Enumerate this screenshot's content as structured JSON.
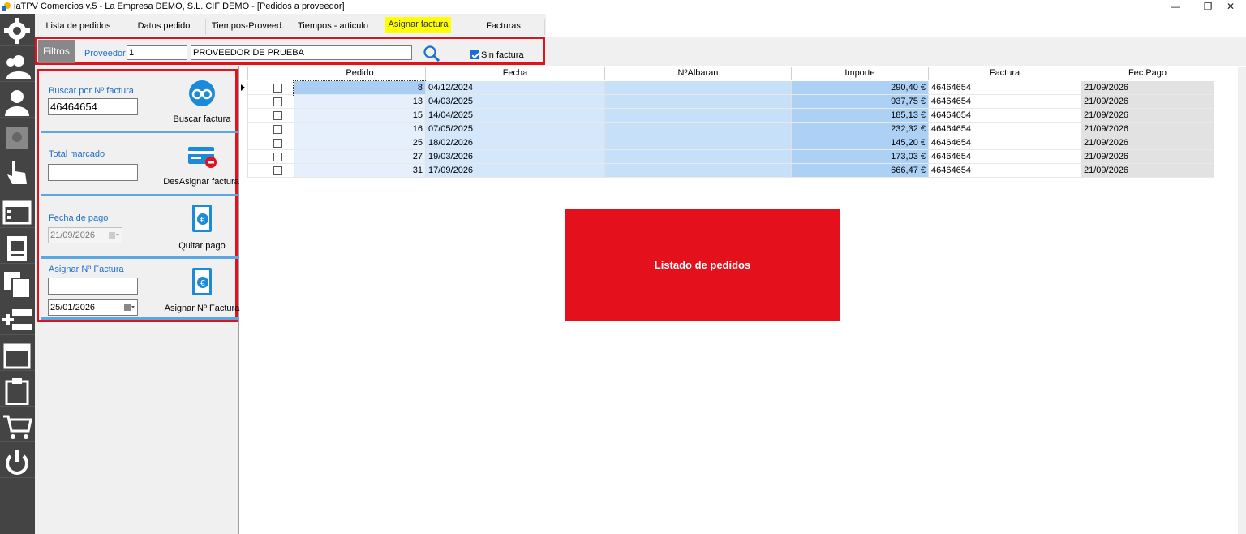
{
  "window": {
    "title": "iaTPV Comercios v.5 - La Empresa DEMO, S.L. CIF DEMO - [Pedidos a proveedor]",
    "controls": {
      "minimize": "—",
      "maximize": "❐",
      "close": "✕"
    }
  },
  "toolbar": {
    "items": [
      {
        "icon": "gear-icon"
      },
      {
        "icon": "users-icon"
      },
      {
        "icon": "user-icon"
      },
      {
        "icon": "safe-icon"
      },
      {
        "icon": "hand-pointer-icon"
      },
      {
        "icon": "browser-window-icon"
      },
      {
        "icon": "invoice-icon"
      },
      {
        "icon": "documents-icon"
      },
      {
        "icon": "add-row-icon"
      },
      {
        "icon": "panel-icon"
      },
      {
        "icon": "clipboard-icon"
      },
      {
        "icon": "cart-icon"
      },
      {
        "icon": "power-icon"
      }
    ]
  },
  "tabs": [
    {
      "label": "Lista de pedidos",
      "active": false
    },
    {
      "label": "Datos pedido",
      "active": false
    },
    {
      "label": "Tiempos-Proveed.",
      "active": false
    },
    {
      "label": "Tiempos - articulo",
      "active": false
    },
    {
      "label": "Asignar factura",
      "active": true
    },
    {
      "label": "Facturas",
      "active": false
    }
  ],
  "filters": {
    "section_label": "Filtros",
    "proveedor_label": "Proveedor",
    "proveedor_code": "1",
    "proveedor_name": "PROVEEDOR DE PRUEBA",
    "sin_factura_label": "Sin factura",
    "sin_factura_checked": true,
    "search_icon": "search-icon"
  },
  "actions": {
    "buscar": {
      "label": "Buscar por Nº factura",
      "value": "46464654",
      "button": "Buscar factura",
      "icon": "binoculars-icon"
    },
    "total": {
      "label": "Total marcado",
      "value": "",
      "button": "DesAsignar factura",
      "icon": "card-remove-icon"
    },
    "fecha_pago": {
      "label": "Fecha de pago",
      "value": "21/09/2026",
      "button": "Quitar pago",
      "icon": "euro-book-icon"
    },
    "asignar": {
      "label": "Asignar Nº Factura",
      "value": "",
      "date": "25/01/2026",
      "button": "Asignar Nº Factura",
      "icon": "euro-book-icon"
    }
  },
  "grid": {
    "columns": [
      "",
      "Pedido",
      "Fecha",
      "NºAlbaran",
      "Importe",
      "Factura",
      "Fec.Pago"
    ],
    "rows": [
      {
        "pedido": "8",
        "fecha": "04/12/2024",
        "albaran": "",
        "importe": "290,40 €",
        "factura": "46464654",
        "fec_pago": "21/09/2026",
        "current": true
      },
      {
        "pedido": "13",
        "fecha": "04/03/2025",
        "albaran": "",
        "importe": "937,75 €",
        "factura": "46464654",
        "fec_pago": "21/09/2026",
        "current": false
      },
      {
        "pedido": "15",
        "fecha": "14/04/2025",
        "albaran": "",
        "importe": "185,13 €",
        "factura": "46464654",
        "fec_pago": "21/09/2026",
        "current": false
      },
      {
        "pedido": "16",
        "fecha": "07/05/2025",
        "albaran": "",
        "importe": "232,32 €",
        "factura": "46464654",
        "fec_pago": "21/09/2026",
        "current": false
      },
      {
        "pedido": "25",
        "fecha": "18/02/2026",
        "albaran": "",
        "importe": "145,20 €",
        "factura": "46464654",
        "fec_pago": "21/09/2026",
        "current": false
      },
      {
        "pedido": "27",
        "fecha": "19/03/2026",
        "albaran": "",
        "importe": "173,03 €",
        "factura": "46464654",
        "fec_pago": "21/09/2026",
        "current": false
      },
      {
        "pedido": "31",
        "fecha": "17/09/2026",
        "albaran": "",
        "importe": "666,47 €",
        "factura": "46464654",
        "fec_pago": "21/09/2026",
        "current": false
      }
    ]
  },
  "annotation": {
    "text": "Listado de pedidos"
  },
  "colors": {
    "highlight": "#e4101c",
    "accent_blue": "#1e6fc9",
    "toolbar_bg": "#444444",
    "active_tab": "#ffff00"
  }
}
